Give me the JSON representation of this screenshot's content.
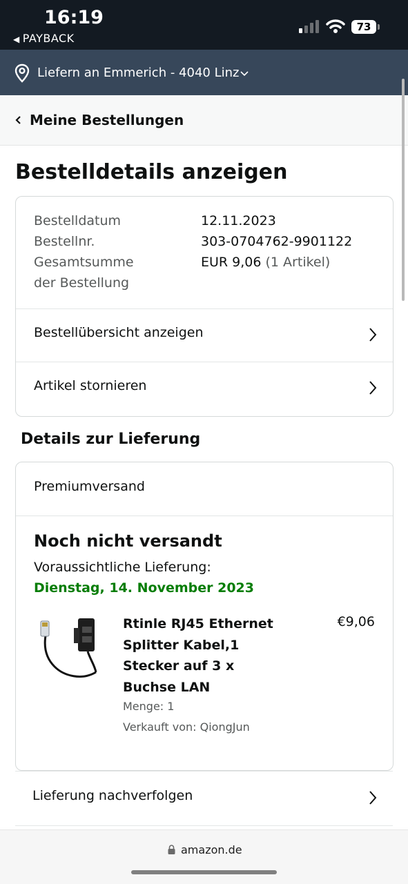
{
  "status_bar": {
    "time": "16:19",
    "back_app": "PAYBACK",
    "battery": "73"
  },
  "delivery_bar": {
    "text": "Liefern an Emmerich - 4040 Linz"
  },
  "breadcrumb": {
    "label": "Meine Bestellungen"
  },
  "page_title": "Bestelldetails anzeigen",
  "order_info": {
    "date_label": "Bestelldatum",
    "date_value": "12.11.2023",
    "number_label": "Bestellnr.",
    "number_value": "303-0704762-9901122",
    "total_label_line1": "Gesamtsumme",
    "total_label_line2": "der Bestellung",
    "total_value": "EUR 9,06",
    "total_items": "(1 Artikel)"
  },
  "order_actions": [
    {
      "label": "Bestellübersicht anzeigen"
    },
    {
      "label": "Artikel stornieren"
    }
  ],
  "delivery_section": {
    "title": "Details zur Lieferung",
    "shipping_method": "Premiumversand",
    "status": "Noch nicht versandt",
    "eta_label": "Voraussichtliche Lieferung:",
    "eta_date": "Dienstag, 14. November 2023"
  },
  "product": {
    "title": "Rtinle RJ45 Ethernet Splitter Kabel,1 Stecker auf 3 x Buchse LAN",
    "price": "€9,06",
    "quantity": "Menge: 1",
    "seller": "Verkauft von: QiongJun"
  },
  "track_link": {
    "label": "Lieferung nachverfolgen"
  },
  "browser": {
    "url": "amazon.de"
  },
  "colors": {
    "status_bar_bg": "#131a22",
    "delivery_bar_bg": "#37475a",
    "delivery_date_green": "#067d06"
  }
}
